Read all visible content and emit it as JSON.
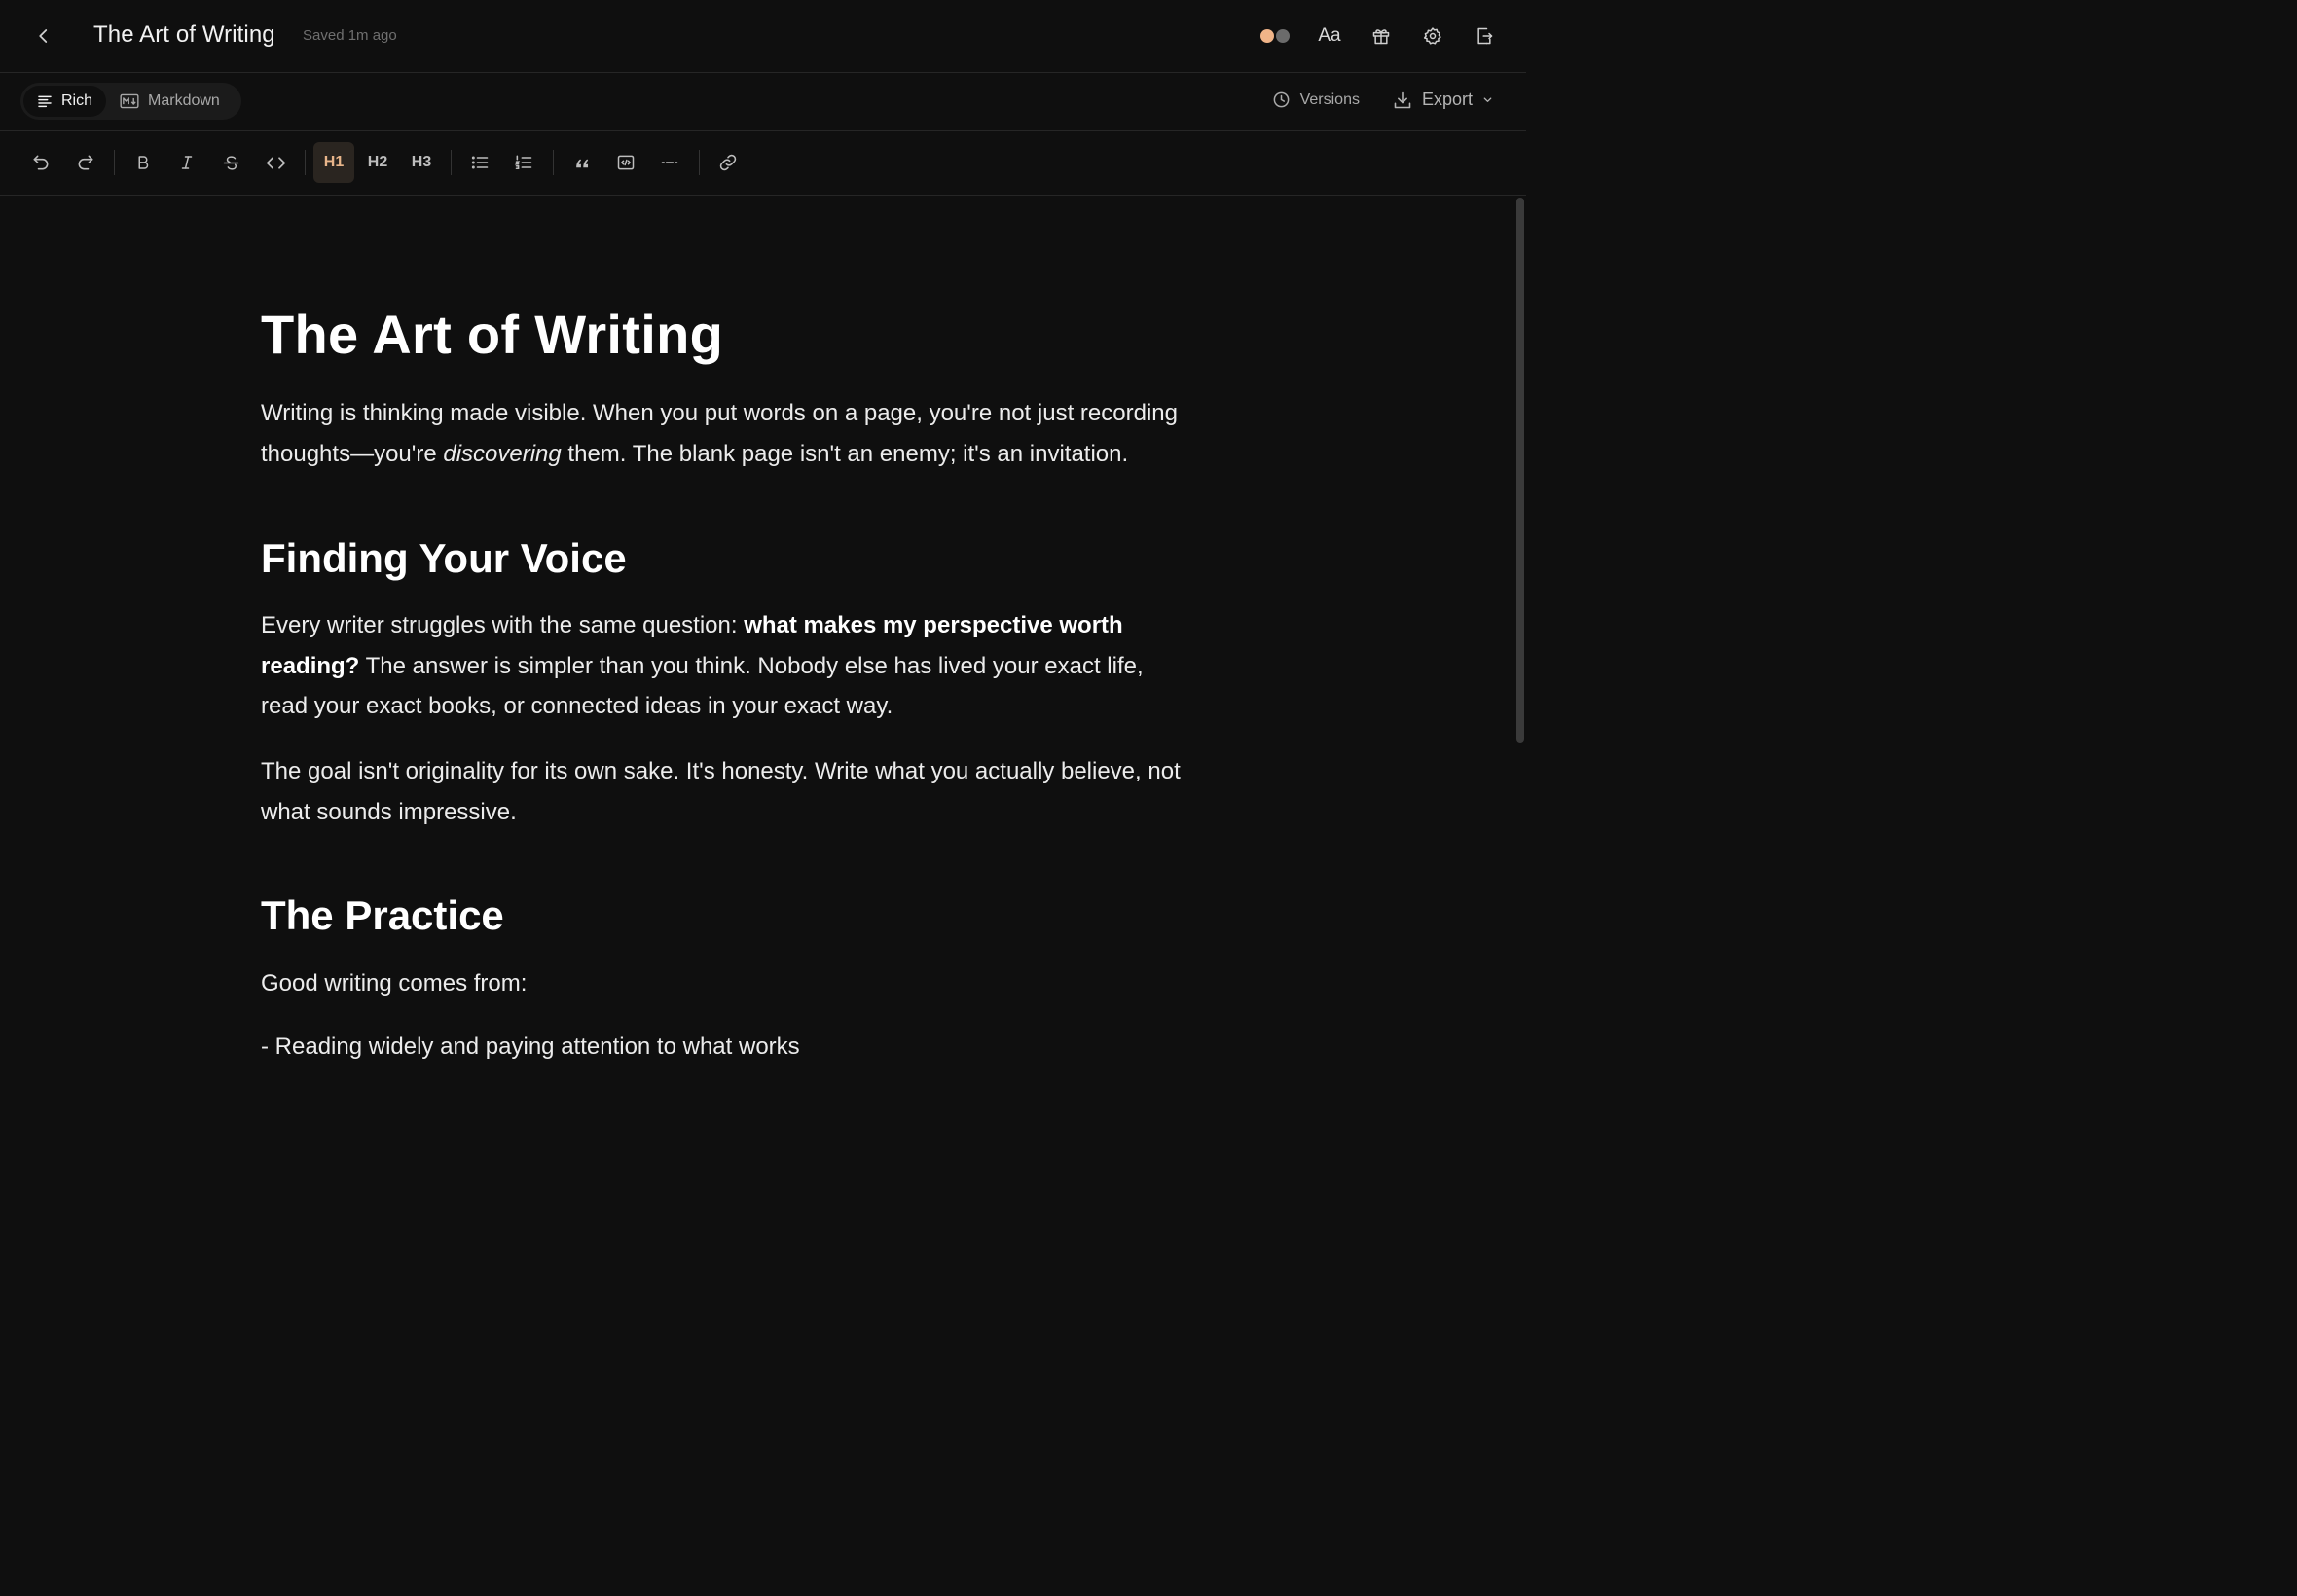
{
  "header": {
    "title": "The Art of Writing",
    "saved_status": "Saved 1m ago",
    "font_button": "Aa",
    "theme_colors": {
      "light": "#f0b488",
      "dark": "#6b6b6b"
    }
  },
  "mode_bar": {
    "modes": [
      {
        "label": "Rich",
        "icon": "align-left-icon",
        "active": true
      },
      {
        "label": "Markdown",
        "icon": "markdown-icon",
        "active": false
      }
    ],
    "versions_label": "Versions",
    "export_label": "Export"
  },
  "toolbar": {
    "headings": [
      "H1",
      "H2",
      "H3"
    ],
    "active_heading": "H1",
    "accent_color": "#e8b58a"
  },
  "document": {
    "title": "The Art of Writing",
    "intro": {
      "part1": "Writing is thinking made visible. When you put words on a page, you're not just recording thoughts—you're ",
      "emphasis": "discovering",
      "part2": " them. The blank page isn't an enemy; it's an invitation."
    },
    "section1_heading": "Finding Your Voice",
    "section1_p1": {
      "part1": "Every writer struggles with the same question: ",
      "bold": "what makes my perspective worth reading?",
      "part2": " The answer is simpler than you think. Nobody else has lived your exact life, read your exact books, or connected ideas in your exact way."
    },
    "section1_p2": "The goal isn't originality for its own sake. It's honesty. Write what you actually believe, not what sounds impressive.",
    "section2_heading": "The Practice",
    "section2_p1": "Good writing comes from:",
    "section2_list_item1": "- Reading widely and paying attention to what works"
  }
}
